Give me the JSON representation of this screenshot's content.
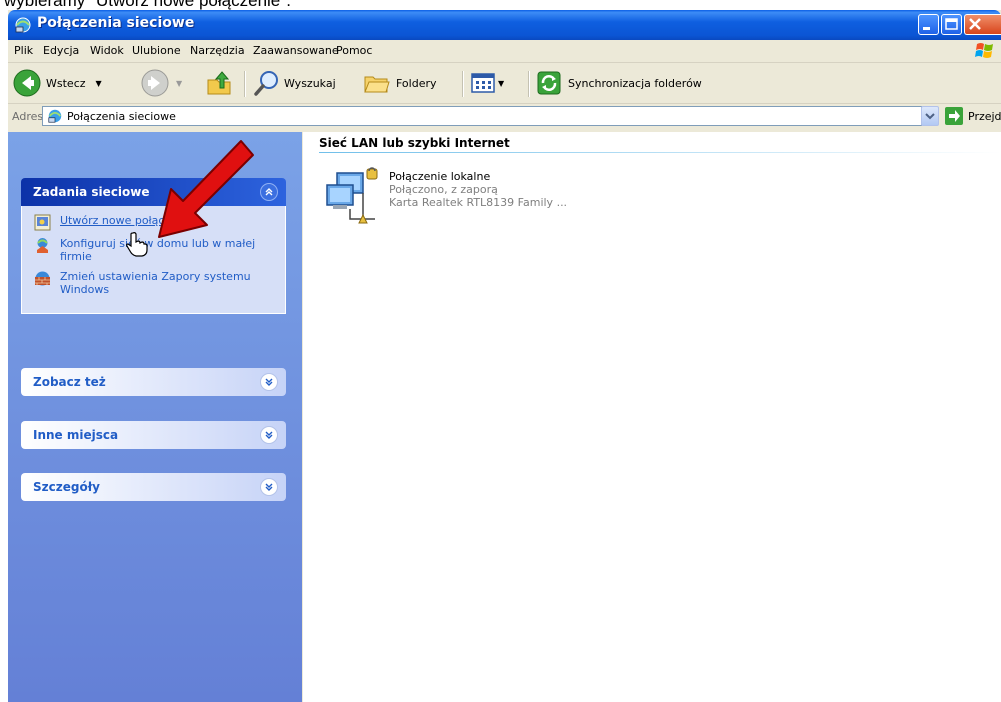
{
  "caption": "wybieramy \"Utwórz nowe połączenie\".",
  "window": {
    "title": "Połączenia sieciowe",
    "icon": "network-connections-icon"
  },
  "menu": {
    "items": [
      "Plik",
      "Edycja",
      "Widok",
      "Ulubione",
      "Narzędzia",
      "Zaawansowane",
      "Pomoc"
    ]
  },
  "toolbar": {
    "back_label": "Wstecz",
    "search_label": "Wyszukaj",
    "folders_label": "Foldery",
    "sync_label": "Synchronizacja folderów"
  },
  "address": {
    "label": "Adres",
    "value": "Połączenia sieciowe",
    "go_label": "Przejdź"
  },
  "sidebar": {
    "panels": [
      {
        "title": "Zadania sieciowe",
        "expanded": true,
        "tasks": [
          {
            "label": "Utwórz nowe połączenie",
            "icon": "new-connection-icon"
          },
          {
            "label": "Konfiguruj sieć w domu lub w małej firmie",
            "icon": "home-network-icon"
          },
          {
            "label": "Zmień ustawienia Zapory systemu Windows",
            "icon": "firewall-icon"
          }
        ]
      },
      {
        "title": "Zobacz też",
        "expanded": false
      },
      {
        "title": "Inne miejsca",
        "expanded": false
      },
      {
        "title": "Szczegóły",
        "expanded": false
      }
    ]
  },
  "content": {
    "group_title": "Sieć LAN lub szybki Internet",
    "connection": {
      "name": "Połączenie lokalne",
      "status": "Połączono, z zaporą",
      "device": "Karta Realtek RTL8139 Family ..."
    }
  },
  "colors": {
    "titlebar": "#0b55d4",
    "link": "#215dc6",
    "sidebar": "#7ba2e7",
    "annotation_arrow": "#e01010"
  }
}
